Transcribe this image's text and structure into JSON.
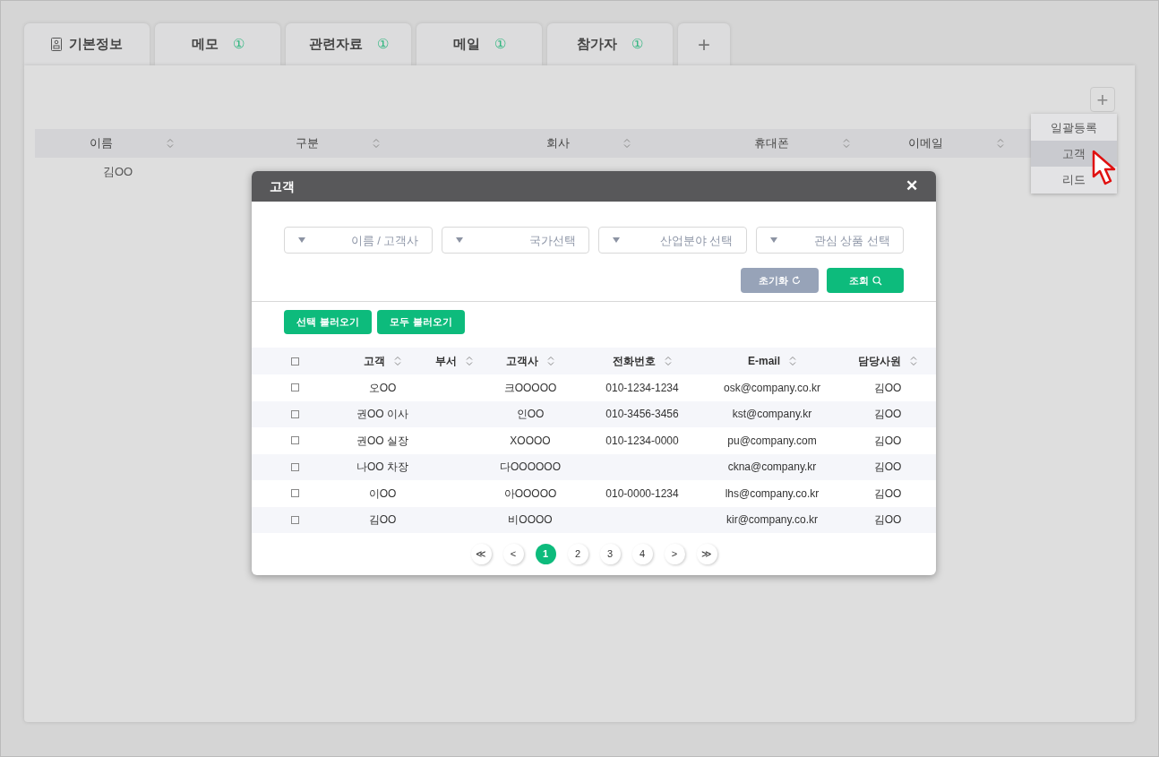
{
  "tabs": [
    {
      "kind": "icon",
      "label": "기본정보"
    },
    {
      "kind": "badge",
      "label": "메모",
      "badge": "①"
    },
    {
      "kind": "badge",
      "label": "관련자료",
      "badge": "①"
    },
    {
      "kind": "badge",
      "label": "메일",
      "badge": "①"
    },
    {
      "kind": "badge",
      "label": "참가자",
      "badge": "①"
    },
    {
      "kind": "add",
      "label": "+"
    }
  ],
  "add_button": "+",
  "add_menu": [
    {
      "label": "일괄등록",
      "selected": false
    },
    {
      "label": "고객",
      "selected": true
    },
    {
      "label": "리드",
      "selected": false
    }
  ],
  "table": {
    "columns": [
      "이름",
      "구분",
      "회사",
      "휴대폰",
      "이메일"
    ],
    "rows": [
      [
        "김OO"
      ]
    ]
  },
  "modal": {
    "title": "고객",
    "close": "✕",
    "filters": [
      {
        "placeholder": "이름 / 고객사"
      },
      {
        "placeholder": "국가선택"
      },
      {
        "placeholder": "산업분야 선택"
      },
      {
        "placeholder": "관심 상품 선택"
      }
    ],
    "reset_button": "초기화",
    "search_button": "조회",
    "load_buttons": [
      "선택 불러오기",
      "모두 불러오기"
    ],
    "columns": [
      "고객",
      "부서",
      "고객사",
      "전화번호",
      "E-mail",
      "담당사원"
    ],
    "header_checked": false,
    "rows": [
      {
        "checked": false,
        "cells": [
          "오OO",
          "",
          "크OOOOO",
          "010-1234-1234",
          "osk@company.co.kr",
          "김OO"
        ]
      },
      {
        "checked": false,
        "cells": [
          "권OO 이사",
          "",
          "인OO",
          "010-3456-3456",
          "kst@company.kr",
          "김OO"
        ]
      },
      {
        "checked": false,
        "cells": [
          "권OO 실장",
          "",
          "XOOOO",
          "010-1234-0000",
          "pu@company.com",
          "김OO"
        ]
      },
      {
        "checked": false,
        "cells": [
          "나OO 차장",
          "",
          "다OOOOOO",
          "",
          "ckna@company.kr",
          "김OO"
        ]
      },
      {
        "checked": false,
        "cells": [
          "이OO",
          "",
          "아OOOOO",
          "010-0000-1234",
          "lhs@company.co.kr",
          "김OO"
        ]
      },
      {
        "checked": false,
        "cells": [
          "김OO",
          "",
          "비OOOO",
          "",
          "kir@company.co.kr",
          "김OO"
        ]
      }
    ],
    "pagination": [
      {
        "label": "≪",
        "selected": false
      },
      {
        "label": "<",
        "selected": false
      },
      {
        "label": "1",
        "selected": true
      },
      {
        "label": "2",
        "selected": false
      },
      {
        "label": "3",
        "selected": false
      },
      {
        "label": "4",
        "selected": false
      },
      {
        "label": ">",
        "selected": false
      },
      {
        "label": "≫",
        "selected": false
      }
    ]
  }
}
